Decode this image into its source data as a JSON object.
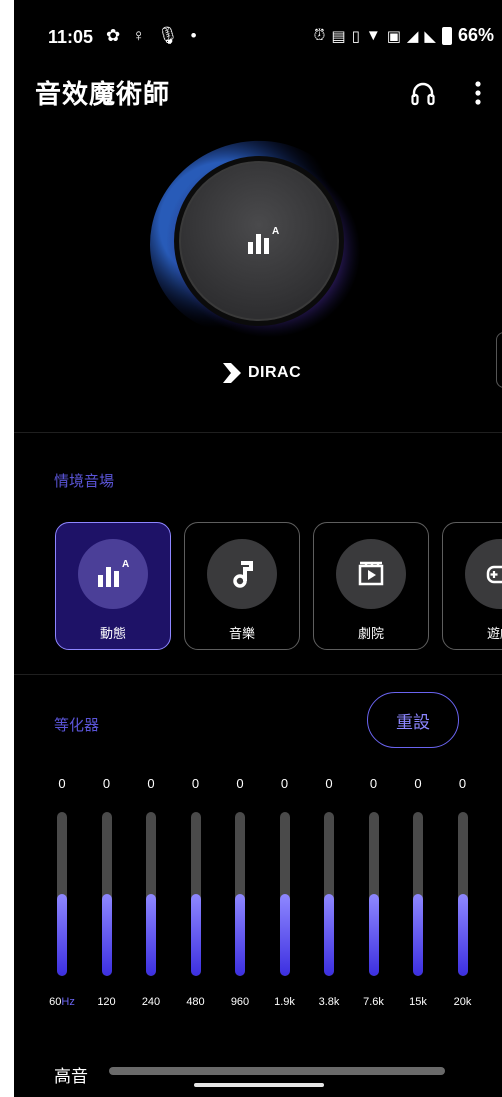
{
  "status_bar": {
    "time": "11:05",
    "battery_text": "66%"
  },
  "app": {
    "title": "音效魔術師"
  },
  "hero": {
    "brand": "DIRAC",
    "icon_badge": "A"
  },
  "scenes": {
    "label": "情境音場",
    "items": [
      {
        "label": "動態",
        "icon": "dynamic-eq-icon",
        "active": true
      },
      {
        "label": "音樂",
        "icon": "music-note-icon",
        "active": false
      },
      {
        "label": "劇院",
        "icon": "movie-icon",
        "active": false
      },
      {
        "label": "遊戲",
        "icon": "gamepad-icon",
        "active": false
      }
    ]
  },
  "equalizer": {
    "label": "等化器",
    "reset_label": "重設",
    "hz_unit": "Hz",
    "bands": [
      {
        "freq": "60",
        "value": "0",
        "level": 0.5
      },
      {
        "freq": "120",
        "value": "0",
        "level": 0.5
      },
      {
        "freq": "240",
        "value": "0",
        "level": 0.5
      },
      {
        "freq": "480",
        "value": "0",
        "level": 0.5
      },
      {
        "freq": "960",
        "value": "0",
        "level": 0.5
      },
      {
        "freq": "1.9k",
        "value": "0",
        "level": 0.5
      },
      {
        "freq": "3.8k",
        "value": "0",
        "level": 0.5
      },
      {
        "freq": "7.6k",
        "value": "0",
        "level": 0.5
      },
      {
        "freq": "15k",
        "value": "0",
        "level": 0.5
      },
      {
        "freq": "20k",
        "value": "0",
        "level": 0.5
      }
    ]
  },
  "treble": {
    "label": "高音"
  },
  "colors": {
    "accent": "#6a64f0",
    "active_card": "#1e1267",
    "background": "#000000"
  }
}
